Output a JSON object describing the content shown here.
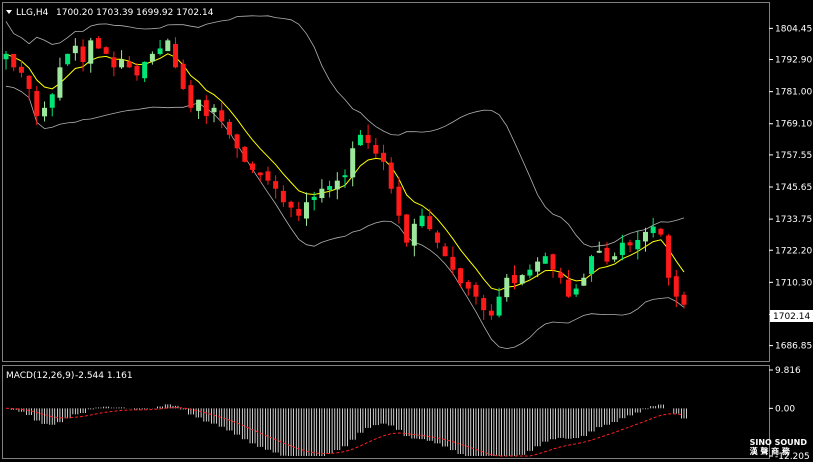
{
  "header": {
    "symbol": "LLG,H4",
    "ohlc": "1700.20 1703.39 1699.92 1702.14"
  },
  "macd_header": {
    "label": "MACD(12,26,9)",
    "values": "-2.544 1.161"
  },
  "price_axis": {
    "ticks": [
      "1804.45",
      "1792.90",
      "1781.00",
      "1769.10",
      "1757.55",
      "1745.65",
      "1733.75",
      "1722.20",
      "1710.30",
      "1698.40",
      "1686.85"
    ],
    "current_price": "1702.14"
  },
  "macd_axis": {
    "ticks": [
      "9.816",
      "0.00",
      "-12.205"
    ]
  },
  "brand": {
    "name": "SINO SOUND",
    "sub": "漢 聲 商 務"
  },
  "colors": {
    "up": "#00e676",
    "up_soft": "#9ee89e",
    "down": "#ff1a1a",
    "ma": "#ffff00",
    "band": "#b0b0b0",
    "signal": "#ff2020",
    "histogram": "#ffffff",
    "background": "#000000",
    "grid": "#7f7f7f"
  },
  "chart_data": [
    {
      "type": "candlestick",
      "title": "LLG,H4",
      "y_range": [
        1683,
        1812
      ],
      "bands": "Bollinger Bands",
      "x_count": 89,
      "closes": [
        1795,
        1790,
        1788,
        1782,
        1772,
        1775,
        1780,
        1790,
        1795,
        1798,
        1792,
        1800,
        1797,
        1795,
        1790,
        1793,
        1790,
        1787,
        1792,
        1795,
        1797,
        1800,
        1790,
        1782,
        1775,
        1778,
        1772,
        1775,
        1770,
        1765,
        1760,
        1755,
        1752,
        1750,
        1748,
        1745,
        1740,
        1738,
        1735,
        1740,
        1742,
        1745,
        1746,
        1748,
        1750,
        1760,
        1765,
        1762,
        1758,
        1755,
        1745,
        1735,
        1725,
        1732,
        1735,
        1730,
        1725,
        1720,
        1715,
        1710,
        1708,
        1705,
        1700,
        1698,
        1705,
        1712,
        1710,
        1713,
        1715,
        1718,
        1720,
        1715,
        1712,
        1705,
        1708,
        1712,
        1720,
        1722,
        1718,
        1720,
        1725,
        1724,
        1726,
        1729,
        1731,
        1728,
        1712,
        1705,
        1702
      ]
    },
    {
      "type": "bar",
      "title": "MACD(12,26,9)",
      "y_range": [
        -12.205,
        9.816
      ]
    }
  ]
}
